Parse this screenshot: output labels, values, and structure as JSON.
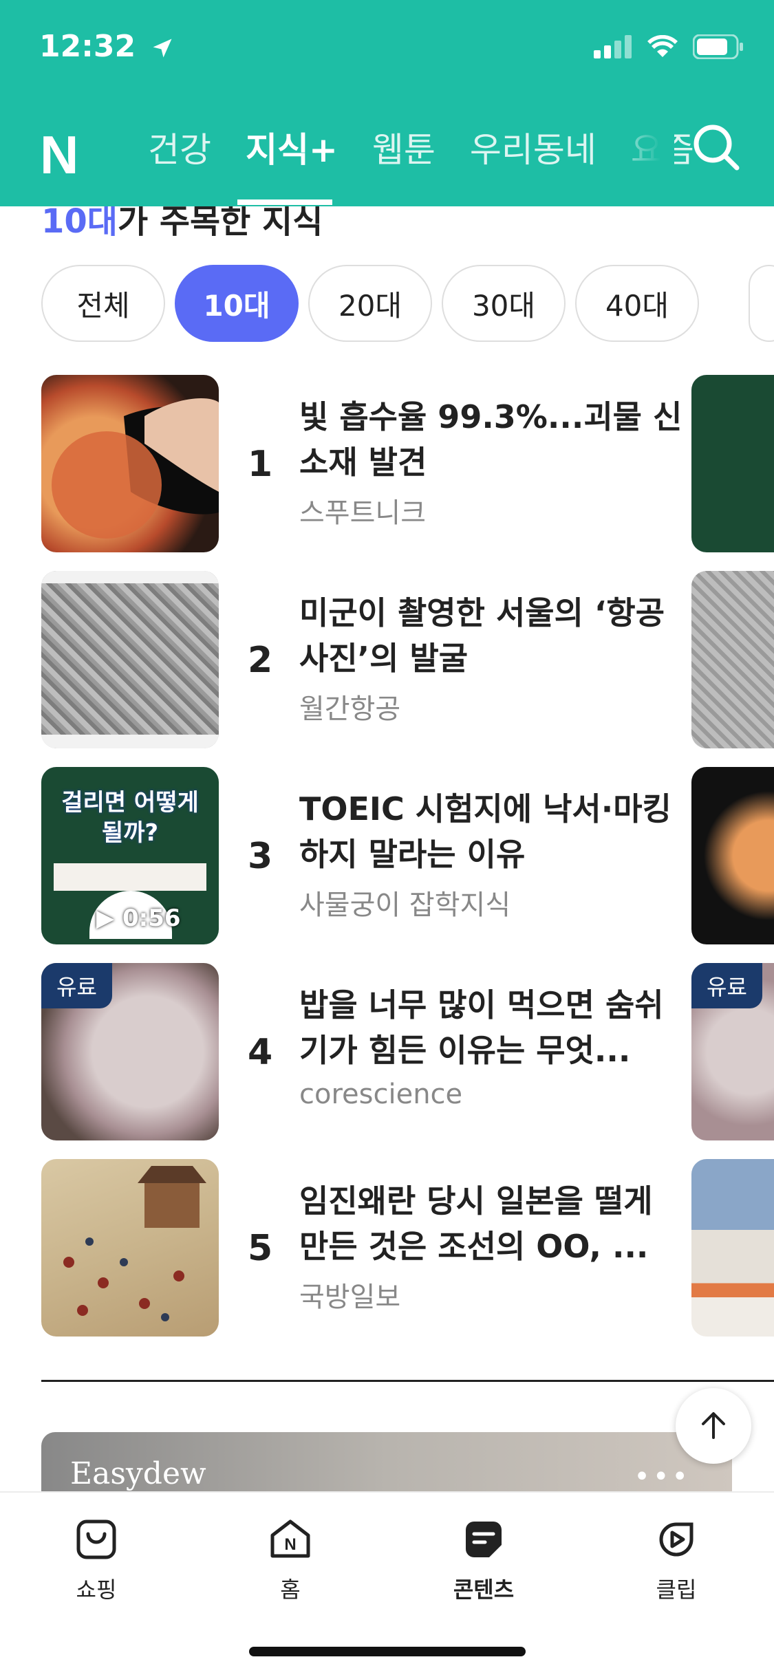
{
  "status_bar": {
    "time": "12:32"
  },
  "header": {
    "logo": "N",
    "tabs": [
      {
        "label": "건강",
        "active": false
      },
      {
        "label": "지식+",
        "active": true
      },
      {
        "label": "웹툰",
        "active": false
      },
      {
        "label": "우리동네",
        "active": false
      },
      {
        "label": "요즘",
        "active": false
      }
    ]
  },
  "section": {
    "title_accent": "10대",
    "title_rest": "가 주목한 지식"
  },
  "age_filters": [
    {
      "label": "전체",
      "active": false
    },
    {
      "label": "10대",
      "active": true
    },
    {
      "label": "20대",
      "active": false
    },
    {
      "label": "30대",
      "active": false
    },
    {
      "label": "40대",
      "active": false
    }
  ],
  "articles": [
    {
      "rank": "1",
      "title": "빛 흡수율 99.3%...괴물 신소재 발견",
      "source": "스푸트니크",
      "badge": ""
    },
    {
      "rank": "2",
      "title": "미군이 촬영한 서울의 ‘항공사진’의 발굴",
      "source": "월간항공",
      "badge": ""
    },
    {
      "rank": "3",
      "title": "TOEIC 시험지에 낙서·마킹하지 말라는 이유",
      "source": "사물궁이 잡학지식",
      "badge": "",
      "thumb_text": "걸리면 어떻게 될까?",
      "duration": "0:56"
    },
    {
      "rank": "4",
      "title": "밥을 너무 많이 먹으면 숨쉬기가 힘든 이유는 무엇...",
      "source": "corescience",
      "badge": "유료"
    },
    {
      "rank": "5",
      "title": "임진왜란 당시 일본을 떨게 만든 것은 조선의 OO, ...",
      "source": "국방일보",
      "badge": ""
    }
  ],
  "ad": {
    "brand": "Easydew"
  },
  "bottom_nav": [
    {
      "label": "쇼핑",
      "icon": "shopping-bag-icon",
      "active": false
    },
    {
      "label": "홈",
      "icon": "home-icon",
      "active": false
    },
    {
      "label": "콘텐츠",
      "icon": "contents-icon",
      "active": true
    },
    {
      "label": "클립",
      "icon": "clip-play-icon",
      "active": false
    }
  ],
  "colors": {
    "brand": "#1ebea5",
    "accent": "#5a6bf5",
    "badge": "#1b3a6b"
  }
}
